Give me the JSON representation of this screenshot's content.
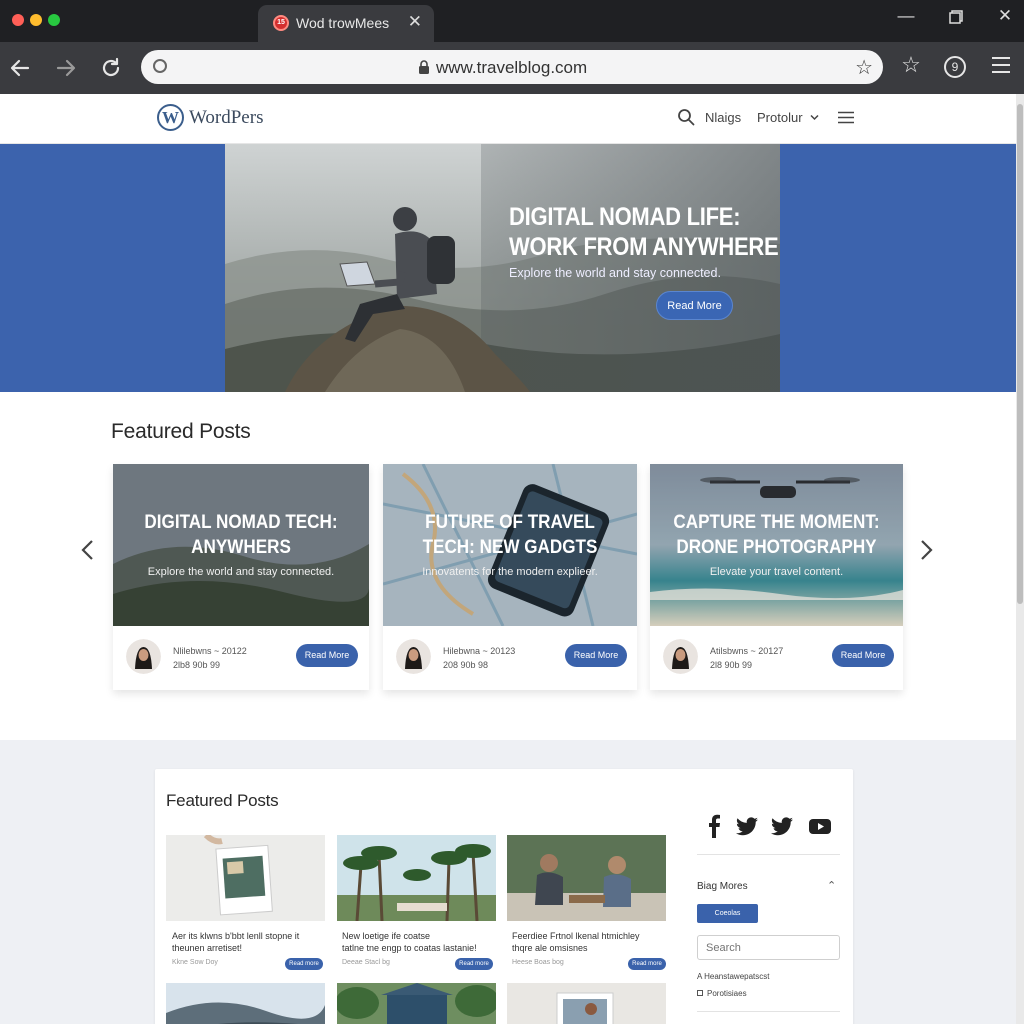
{
  "browser": {
    "tab_title": "Wod trowMees",
    "tab_favicon": "15",
    "url": "www.travelblog.com",
    "traffic_colors": [
      "#ff5f57",
      "#febc2e",
      "#28c840"
    ],
    "icons": [
      "back-arrow-icon",
      "forward-arrow-icon",
      "reload-icon",
      "lock-icon",
      "star-icon",
      "bookmark-star-icon",
      "profile-icon",
      "menu-icon"
    ],
    "profile_badge": "9"
  },
  "site": {
    "name": "WordPers",
    "logo_letter": "W",
    "nav": [
      "Nlaigs",
      "Protolur"
    ],
    "accent": "#3a62ab"
  },
  "hero": {
    "title_line1": "DIGITAL NOMAD LIFE:",
    "title_line2": "WORK FROM ANYWHERE",
    "subtitle": "Explore the world and stay connected.",
    "button": "Read More"
  },
  "featured": {
    "title": "Featured Posts",
    "cards": [
      {
        "title_line1": "DIGITAL NOMAD TECH:",
        "title_line2": "ANYWHERS",
        "subtitle": "Explore the world and stay connected.",
        "meta_line1": "Nlilebwns ~ 20122",
        "meta_line2": "2lb8 90b 99",
        "button": "Read More"
      },
      {
        "title_line1": "FUTURE OF TRAVEL",
        "title_line2": "TECH: NEW GADGTS",
        "subtitle": "Innovatents for the modern explieer.",
        "meta_line1": "Hilebwna ~ 20123",
        "meta_line2": "208 90b 98",
        "button": "Read More"
      },
      {
        "title_line1": "CAPTURE THE MOMENT:",
        "title_line2": "DRONE PHOTOGRAPHY",
        "subtitle": "Elevate your travel content.",
        "meta_line1": "Atilsbwns ~ 20127",
        "meta_line2": "2l8 90b 99",
        "button": "Read More"
      }
    ],
    "pager_active": 0
  },
  "posts": {
    "title": "Featured Posts",
    "items": [
      {
        "line1": "Aer its klwns b'bbt lenll stopne it",
        "line2": "theunen arretiset!",
        "meta": "Kkne Sow Doy",
        "button": "Read more"
      },
      {
        "line1": "New loetige ife coatse",
        "line2": "tatlne tne engp to coatas lastanie!",
        "meta": "Deeae Stacl bg",
        "button": "Read more"
      },
      {
        "line1": "Feerdiee Frtnol lkenal htmichley",
        "line2": "thqre ale omsisnes",
        "meta": "Heese Boas bog",
        "button": "Read more"
      }
    ]
  },
  "sidebar": {
    "social_icons": [
      "facebook-icon",
      "twitter-icon",
      "twitter-icon",
      "youtube-icon"
    ],
    "title": "Biag Mores",
    "chip": "Coeolas",
    "search_placeholder": "Search",
    "links": [
      "A Heanstawepatscst",
      "Porotisiaes"
    ]
  }
}
